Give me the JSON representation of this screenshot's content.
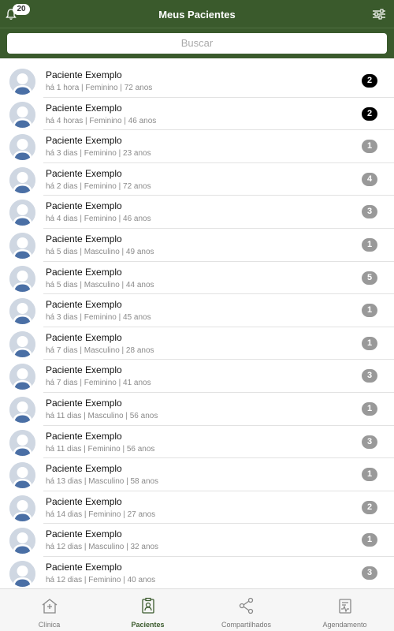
{
  "header": {
    "title": "Meus Pacientes",
    "notification_count": "20",
    "bg_color": "#3a5a2c"
  },
  "search": {
    "placeholder": "Buscar"
  },
  "colors": {
    "badge_dark": "#000000",
    "badge_light": "#999999"
  },
  "patients": [
    {
      "name": "Paciente Exemplo",
      "meta": "há 1 hora | Feminino | 72 anos",
      "count": "2",
      "dark": true
    },
    {
      "name": "Paciente Exemplo",
      "meta": "há 4 horas | Feminino | 46 anos",
      "count": "2",
      "dark": true
    },
    {
      "name": "Paciente Exemplo",
      "meta": "há 3 dias | Feminino | 23 anos",
      "count": "1",
      "dark": false
    },
    {
      "name": "Paciente Exemplo",
      "meta": "há 2 dias | Feminino | 72 anos",
      "count": "4",
      "dark": false
    },
    {
      "name": "Paciente Exemplo",
      "meta": "há 4 dias | Feminino | 46 anos",
      "count": "3",
      "dark": false
    },
    {
      "name": "Paciente Exemplo",
      "meta": "há 5 dias | Masculino | 49 anos",
      "count": "1",
      "dark": false
    },
    {
      "name": "Paciente Exemplo",
      "meta": "há 5 dias | Masculino | 44 anos",
      "count": "5",
      "dark": false
    },
    {
      "name": "Paciente Exemplo",
      "meta": "há 3 dias | Feminino | 45 anos",
      "count": "1",
      "dark": false
    },
    {
      "name": "Paciente Exemplo",
      "meta": "há 7 dias | Masculino | 28 anos",
      "count": "1",
      "dark": false
    },
    {
      "name": "Paciente Exemplo",
      "meta": "há 7 dias | Feminino | 41 anos",
      "count": "3",
      "dark": false
    },
    {
      "name": "Paciente Exemplo",
      "meta": "há 11 dias | Masculino | 56 anos",
      "count": "1",
      "dark": false
    },
    {
      "name": "Paciente Exemplo",
      "meta": "há 11 dias | Feminino | 56 anos",
      "count": "3",
      "dark": false
    },
    {
      "name": "Paciente Exemplo",
      "meta": "há 13 dias | Masculino | 58 anos",
      "count": "1",
      "dark": false
    },
    {
      "name": "Paciente Exemplo",
      "meta": "há 14 dias | Feminino | 27 anos",
      "count": "2",
      "dark": false
    },
    {
      "name": "Paciente Exemplo",
      "meta": "há 12 dias | Masculino | 32 anos",
      "count": "1",
      "dark": false
    },
    {
      "name": "Paciente Exemplo",
      "meta": "há 12 dias | Feminino | 40 anos",
      "count": "3",
      "dark": false
    }
  ],
  "tabs": [
    {
      "label": "Clínica",
      "icon": "clinic-icon",
      "active": false
    },
    {
      "label": "Pacientes",
      "icon": "patients-icon",
      "active": true
    },
    {
      "label": "Compartilhados",
      "icon": "share-icon",
      "active": false
    },
    {
      "label": "Agendamento",
      "icon": "calendar-icon",
      "active": false
    }
  ]
}
